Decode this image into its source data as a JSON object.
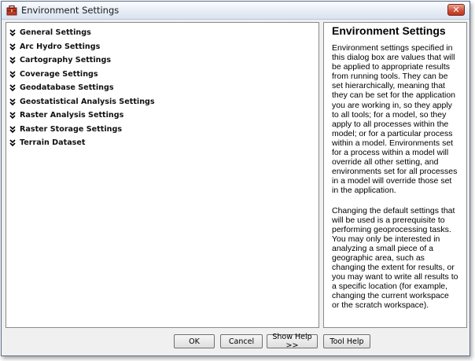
{
  "window": {
    "title": "Environment Settings",
    "close_label": "✕"
  },
  "settings": {
    "items": [
      {
        "label": "General Settings"
      },
      {
        "label": "Arc Hydro Settings"
      },
      {
        "label": "Cartography Settings"
      },
      {
        "label": "Coverage Settings"
      },
      {
        "label": "Geodatabase Settings"
      },
      {
        "label": "Geostatistical Analysis Settings"
      },
      {
        "label": "Raster Analysis Settings"
      },
      {
        "label": "Raster Storage Settings"
      },
      {
        "label": "Terrain Dataset"
      }
    ]
  },
  "help": {
    "title": "Environment Settings",
    "paragraph1": "Environment settings specified in this dialog box are values that will be applied to appropriate results from running tools. They can be set hierarchically, meaning that they can be set for the application you are working in, so they apply to all tools; for a model, so they apply to all processes within the model; or for a particular process within a model. Environments set for a process within a model will override all other setting, and environments set for all processes in a model will override those set in the application.",
    "paragraph2": "Changing the default settings that will be used is a prerequisite to performing geoprocessing tasks. You may only be interested in analyzing a small piece of a geographic area, such as changing the extent for results, or you may want to write all results to a specific location (for example, changing the current workspace or the scratch workspace)."
  },
  "buttons": {
    "ok": "OK",
    "cancel": "Cancel",
    "show_help": "Show Help >>",
    "tool_help": "Tool Help"
  },
  "icons": {
    "app": "toolbox-icon",
    "expand": "double-chevron-down-icon"
  },
  "colors": {
    "close_button": "#c8452e",
    "pane_background": "#ffffff",
    "dialog_background": "#f0f0f0"
  }
}
